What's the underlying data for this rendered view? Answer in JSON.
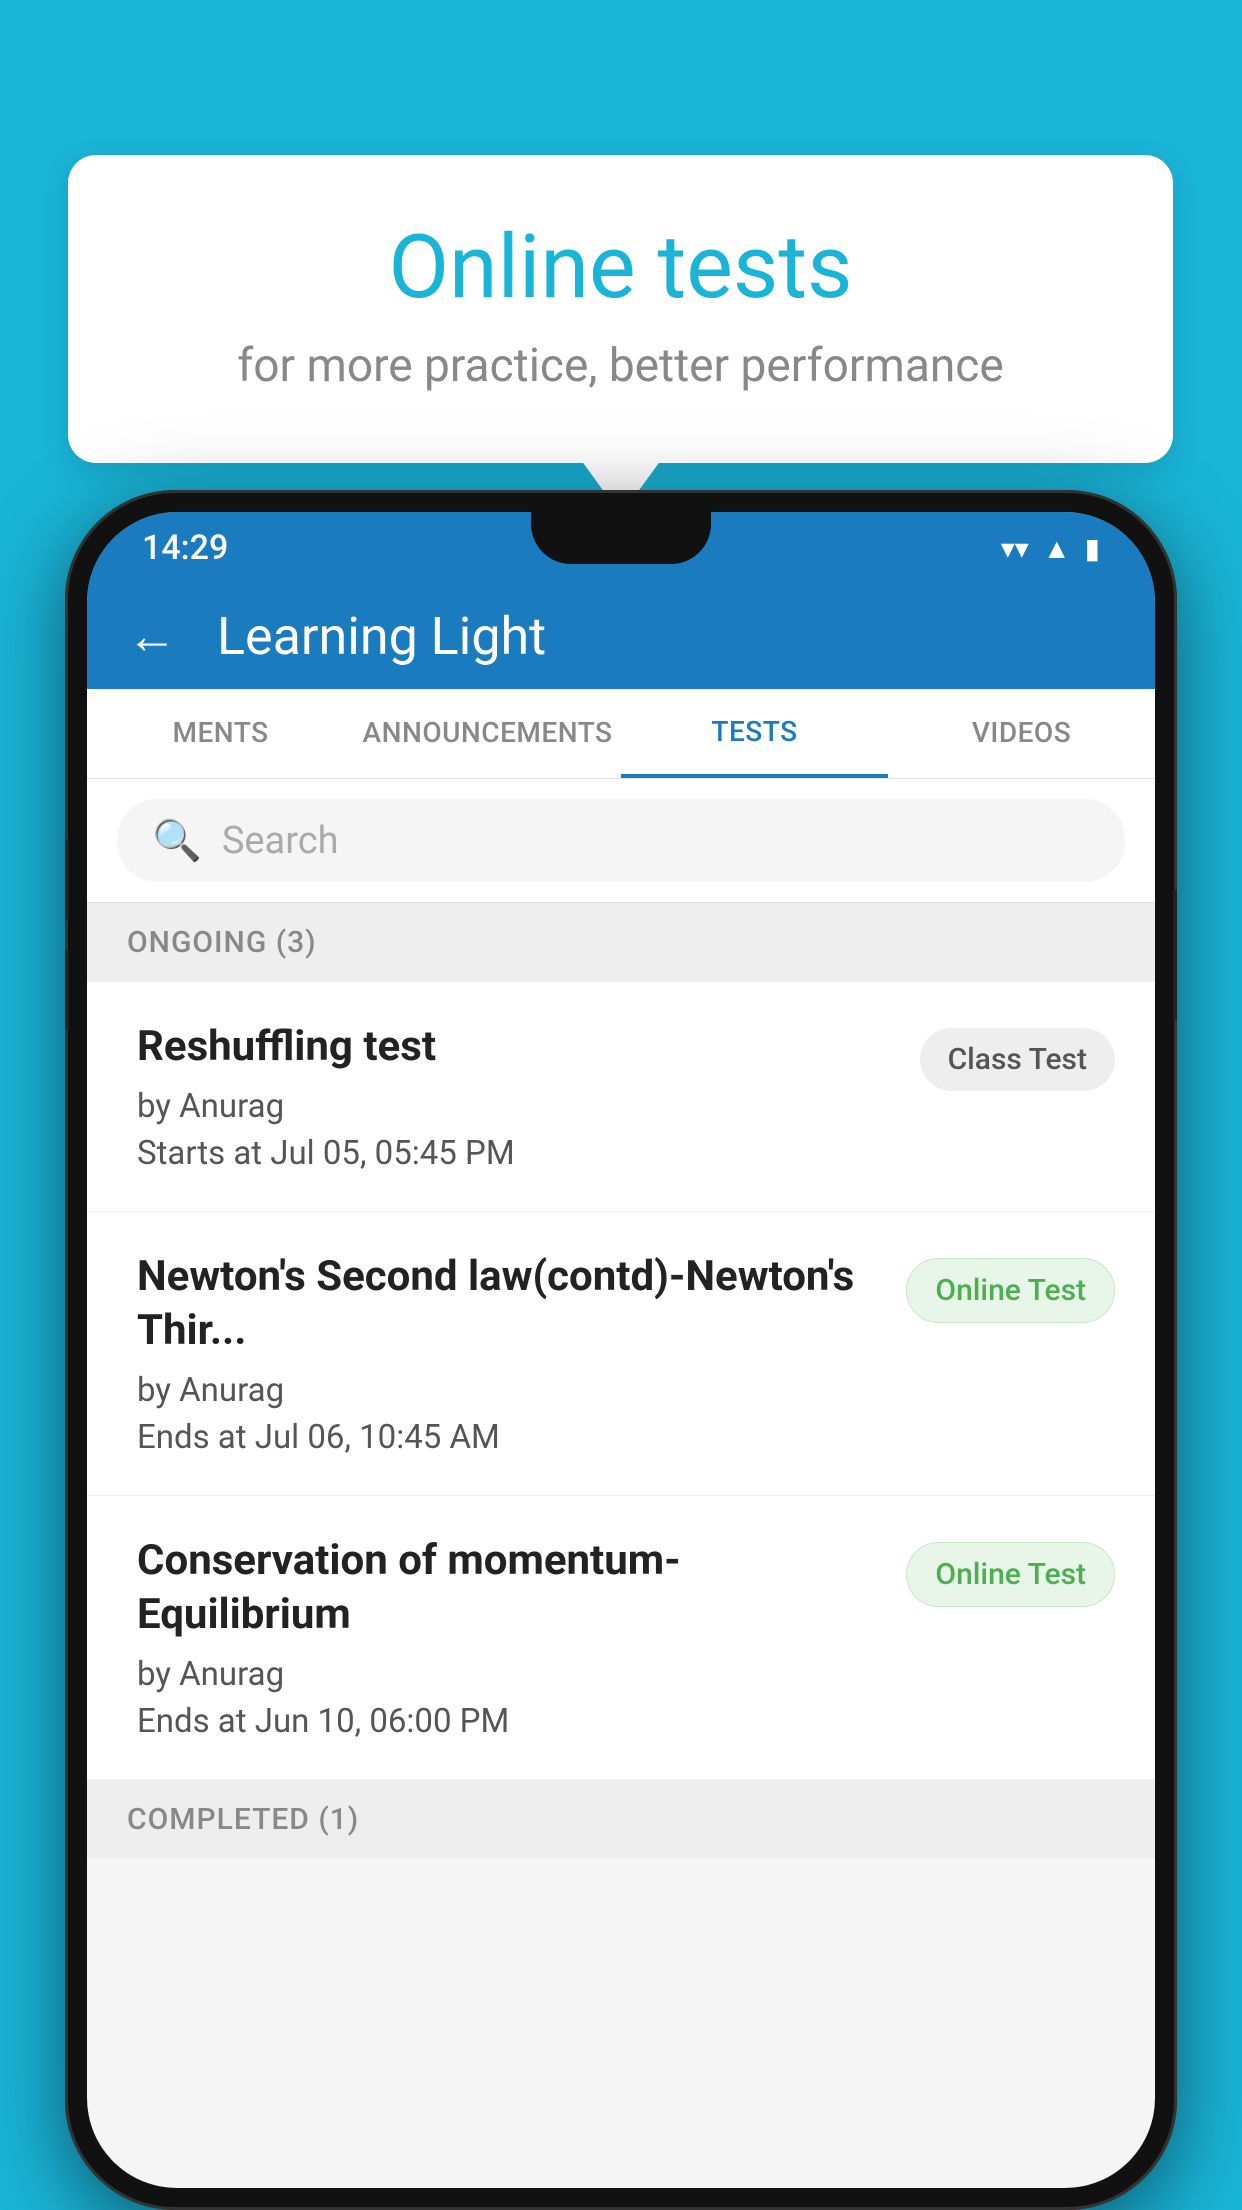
{
  "background_color": "#1ab4d8",
  "speech_bubble": {
    "title": "Online tests",
    "subtitle": "for more practice, better performance"
  },
  "phone": {
    "status_bar": {
      "time": "14:29",
      "signal_icon": "▼",
      "network_icon": "◀",
      "battery_icon": "▮"
    },
    "app_header": {
      "back_label": "←",
      "title": "Learning Light"
    },
    "tabs": [
      {
        "label": "MENTS",
        "active": false
      },
      {
        "label": "ANNOUNCEMENTS",
        "active": false
      },
      {
        "label": "TESTS",
        "active": true
      },
      {
        "label": "VIDEOS",
        "active": false
      }
    ],
    "search": {
      "placeholder": "Search"
    },
    "ongoing_section": {
      "label": "ONGOING (3)",
      "tests": [
        {
          "title": "Reshuffling test",
          "author": "by Anurag",
          "date": "Starts at  Jul 05, 05:45 PM",
          "badge": "Class Test",
          "badge_type": "class"
        },
        {
          "title": "Newton's Second law(contd)-Newton's Thir...",
          "author": "by Anurag",
          "date": "Ends at  Jul 06, 10:45 AM",
          "badge": "Online Test",
          "badge_type": "online"
        },
        {
          "title": "Conservation of momentum-Equilibrium",
          "author": "by Anurag",
          "date": "Ends at  Jun 10, 06:00 PM",
          "badge": "Online Test",
          "badge_type": "online"
        }
      ]
    },
    "completed_section": {
      "label": "COMPLETED (1)"
    }
  }
}
